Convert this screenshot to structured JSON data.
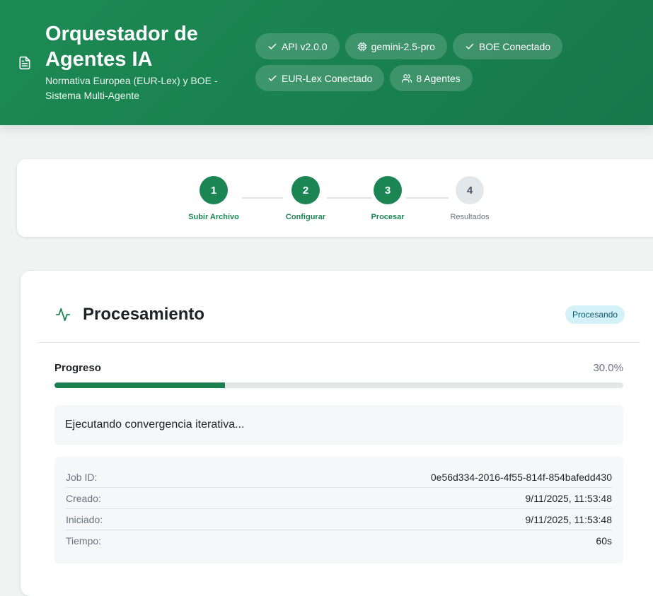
{
  "header": {
    "title": "Orquestador de Agentes IA",
    "subtitle": "Normativa Europea (EUR-Lex) y BOE - Sistema Multi-Agente",
    "badges": [
      {
        "icon": "check-icon",
        "label": "API v2.0.0"
      },
      {
        "icon": "cpu-icon",
        "label": "gemini-2.5-pro"
      },
      {
        "icon": "check-icon",
        "label": "BOE Conectado"
      },
      {
        "icon": "check-icon",
        "label": "EUR-Lex Conectado"
      },
      {
        "icon": "users-icon",
        "label": "8 Agentes"
      }
    ]
  },
  "stepper": {
    "steps": [
      {
        "number": "1",
        "label": "Subir Archivo",
        "state": "complete"
      },
      {
        "number": "2",
        "label": "Configurar",
        "state": "complete"
      },
      {
        "number": "3",
        "label": "Procesar",
        "state": "active"
      },
      {
        "number": "4",
        "label": "Resultados",
        "state": "pending"
      }
    ]
  },
  "processing": {
    "title": "Procesamiento",
    "status": "Procesando",
    "progress_label": "Progreso",
    "progress_text": "30.0%",
    "progress_fraction": 0.3,
    "message": "Ejecutando convergencia iterativa...",
    "details": [
      {
        "key": "Job ID:",
        "value": "0e56d334-2016-4f55-814f-854bafedd430"
      },
      {
        "key": "Creado:",
        "value": "9/11/2025, 11:53:48"
      },
      {
        "key": "Iniciado:",
        "value": "9/11/2025, 11:53:48"
      },
      {
        "key": "Tiempo:",
        "value": "60s"
      }
    ]
  },
  "colors": {
    "brand": "#1b8553",
    "status_badge_bg": "#d3f1f7",
    "progress_fill": "#1b7f4f"
  }
}
